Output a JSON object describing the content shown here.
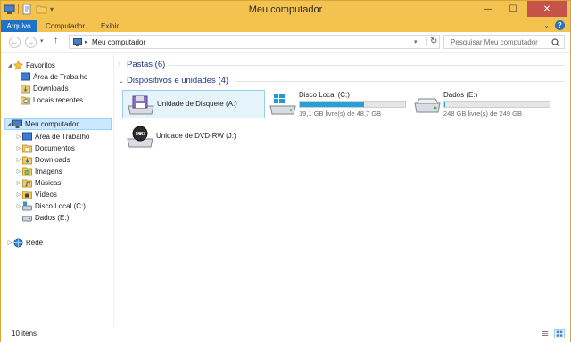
{
  "window": {
    "title": "Meu computador"
  },
  "ribbon": {
    "tabs": [
      "Arquivo",
      "Computador",
      "Exibir"
    ]
  },
  "address": {
    "path": "Meu computador",
    "search_placeholder": "Pesquisar Meu computador"
  },
  "navpane": {
    "favorites": {
      "label": "Favoritos",
      "items": [
        "Área de Trabalho",
        "Downloads",
        "Locais recentes"
      ]
    },
    "computer": {
      "label": "Meu computador",
      "items": [
        "Área de Trabalho",
        "Documentos",
        "Downloads",
        "Imagens",
        "Músicas",
        "Vídeos",
        "Disco Local (C:)",
        "Dados (E:)"
      ]
    },
    "network": {
      "label": "Rede"
    }
  },
  "groups": {
    "folders": "Pastas (6)",
    "devices": "Dispositivos e unidades (4)"
  },
  "drives": [
    {
      "name": "Unidade de Disquete (A:)",
      "free_text": "",
      "used_fraction": null
    },
    {
      "name": "Disco Local (C:)",
      "free_text": "19,1 GB livre(s) de 48,7 GB",
      "used_fraction": 0.608
    },
    {
      "name": "Dados (E:)",
      "free_text": "248 GB livre(s) de 249 GB",
      "used_fraction": 0.004
    },
    {
      "name": "Unidade de DVD-RW (J:)",
      "free_text": "",
      "used_fraction": null
    }
  ],
  "status": {
    "items": "10 itens"
  },
  "colors": {
    "frame": "#f4c24e",
    "file_tab": "#1e72c8",
    "bar_fill": "#26a0da",
    "group_header": "#1e3287",
    "selection": "#cce8ff"
  }
}
